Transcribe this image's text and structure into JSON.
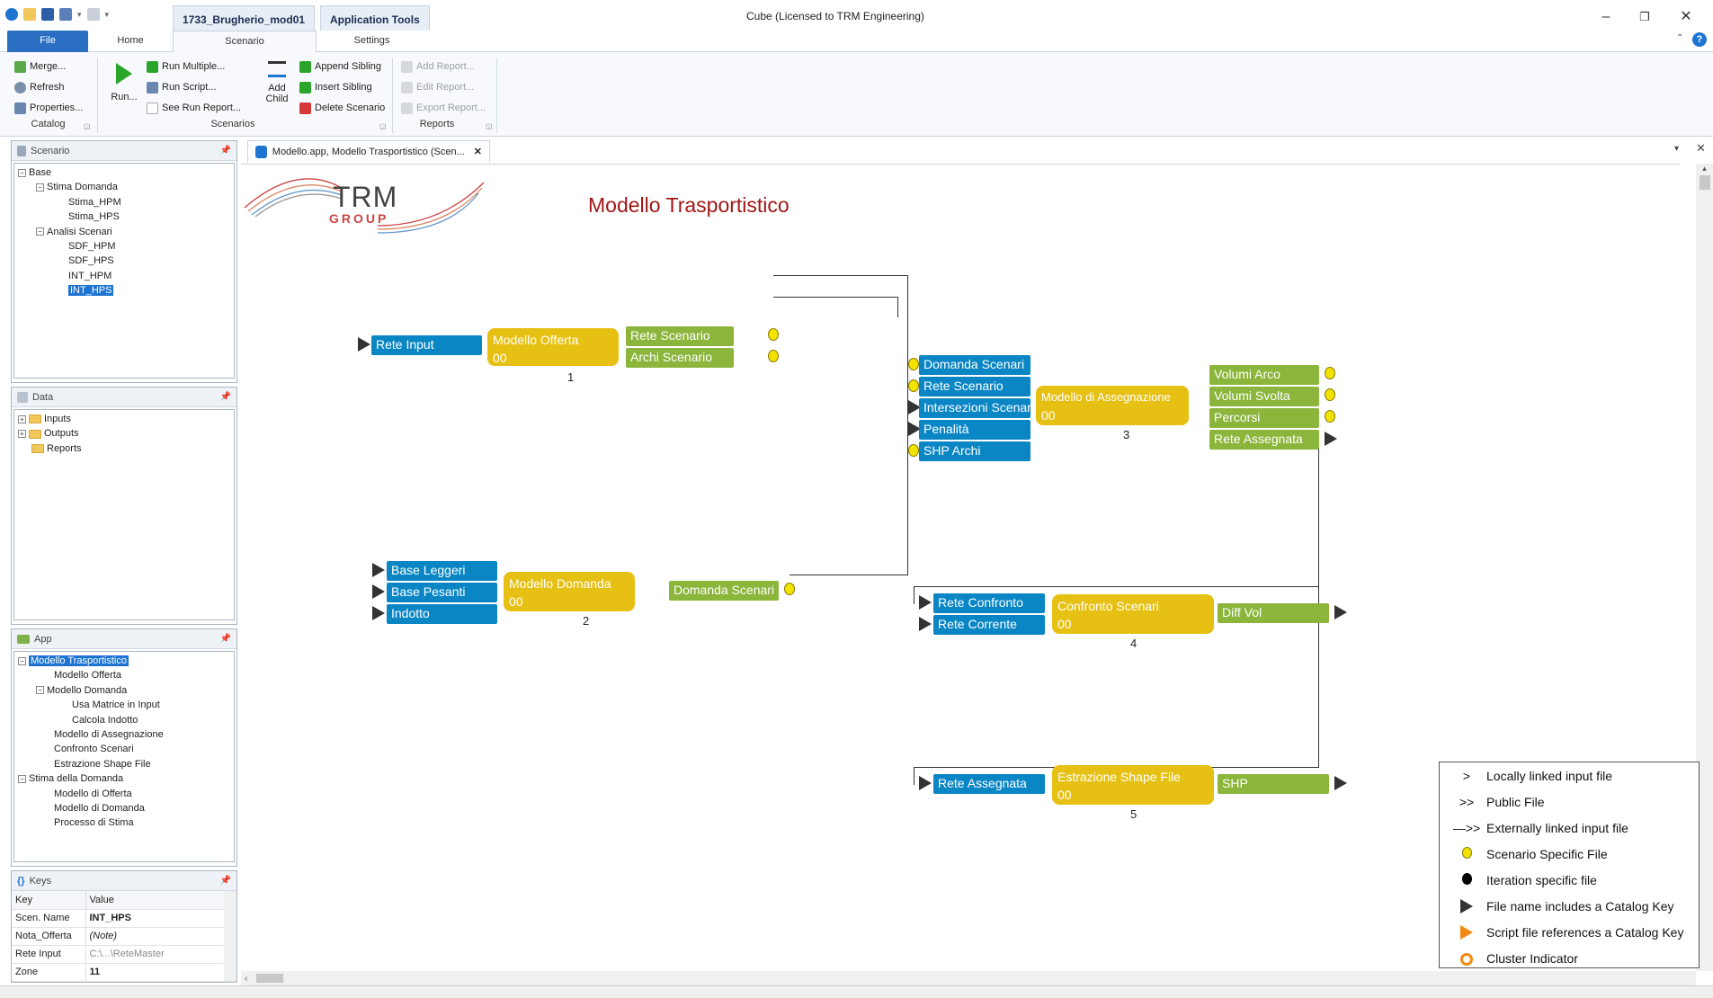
{
  "titlebar": {
    "app_title": "Cube (Licensed to TRM Engineering)",
    "context_tab_1": "1733_Brugherio_mod01",
    "context_tab_2": "Application Tools"
  },
  "ribbon_tabs": {
    "file": "File",
    "home": "Home",
    "scenario": "Scenario",
    "settings": "Settings"
  },
  "ribbon": {
    "catalog": {
      "merge": "Merge...",
      "refresh": "Refresh",
      "properties": "Properties...",
      "label": "Catalog"
    },
    "scenarios": {
      "run": "Run...",
      "run_multiple": "Run Multiple...",
      "run_script": "Run Script...",
      "see_run_report": "See Run Report...",
      "add_child_1": "Add",
      "add_child_2": "Child",
      "append_sibling": "Append Sibling",
      "insert_sibling": "Insert Sibling",
      "delete_scenario": "Delete Scenario",
      "label": "Scenarios"
    },
    "reports": {
      "add": "Add Report...",
      "edit": "Edit Report...",
      "export": "Export Report...",
      "label": "Reports"
    }
  },
  "scenario_panel": {
    "title": "Scenario",
    "tree": [
      "Base",
      "Stima Domanda",
      "Stima_HPM",
      "Stima_HPS",
      "Analisi Scenari",
      "SDF_HPM",
      "SDF_HPS",
      "INT_HPM",
      "INT_HPS"
    ]
  },
  "data_panel": {
    "title": "Data",
    "tree": [
      "Inputs",
      "Outputs",
      "Reports"
    ]
  },
  "app_panel": {
    "title": "App",
    "tree": [
      "Modello Trasportistico",
      "Modello Offerta",
      "Modello Domanda",
      "Usa Matrice in Input",
      "Calcola Indotto",
      "Modello di Assegnazione",
      "Confronto Scenari",
      "Estrazione Shape File",
      "Stima della Domanda",
      "Modello di Offerta",
      "Modello di Domanda",
      "Processo di Stima"
    ]
  },
  "keys_panel": {
    "title": "Keys",
    "headers": [
      "Key",
      "Value"
    ],
    "rows": [
      [
        "Scen. Name",
        "INT_HPS"
      ],
      [
        "Nota_Offerta",
        "(Note)"
      ],
      [
        "Rete Input",
        "C:\\...\\ReteMaster"
      ],
      [
        "Zone",
        "11"
      ]
    ]
  },
  "doc_tab": {
    "label": "Modello.app, Modello Trasportistico (Scen..."
  },
  "canvas": {
    "logo_text_1": "TRM",
    "logo_text_2": "GROUP",
    "title": "Modello Trasportistico",
    "title_color": "#a01616",
    "nodes": {
      "n1": {
        "name": "Modello Offerta",
        "num": "00",
        "index": "1",
        "inputs": [
          "Rete Input"
        ],
        "outputs": [
          "Rete Scenario",
          "Archi Scenario"
        ]
      },
      "n2": {
        "name": "Modello Domanda",
        "num": "00",
        "index": "2",
        "inputs": [
          "Base Leggeri",
          "Base Pesanti",
          "Indotto"
        ],
        "outputs": [
          "Domanda Scenari"
        ]
      },
      "n3": {
        "name": "Modello di Assegnazione",
        "num": "00",
        "index": "3",
        "inputs": [
          "Domanda Scenari",
          "Rete Scenario",
          "Intersezioni Scenari",
          "Penalità",
          "SHP Archi"
        ],
        "outputs": [
          "Volumi Arco",
          "Volumi Svolta",
          "Percorsi",
          "Rete Assegnata"
        ]
      },
      "n4": {
        "name": "Confronto Scenari",
        "num": "00",
        "index": "4",
        "inputs": [
          "Rete Confronto",
          "Rete Corrente"
        ],
        "outputs": [
          "Diff Vol"
        ]
      },
      "n5": {
        "name": "Estrazione Shape File",
        "num": "00",
        "index": "5",
        "inputs": [
          "Rete Assegnata"
        ],
        "outputs": [
          "SHP"
        ]
      }
    }
  },
  "legend": [
    {
      "symbol": ">",
      "label": "Locally linked input file"
    },
    {
      "symbol": ">>",
      "label": "Public File"
    },
    {
      "symbol": "—>>",
      "label": "Externally linked input file"
    },
    {
      "symbol": "yellow-dot",
      "label": "Scenario Specific File"
    },
    {
      "symbol": "black-dot",
      "label": "Iteration specific file"
    },
    {
      "symbol": "black-triangle",
      "label": "File name includes a Catalog Key"
    },
    {
      "symbol": "orange-triangle",
      "label": "Script file references a Catalog Key"
    },
    {
      "symbol": "orange-ring",
      "label": "Cluster Indicator"
    }
  ]
}
